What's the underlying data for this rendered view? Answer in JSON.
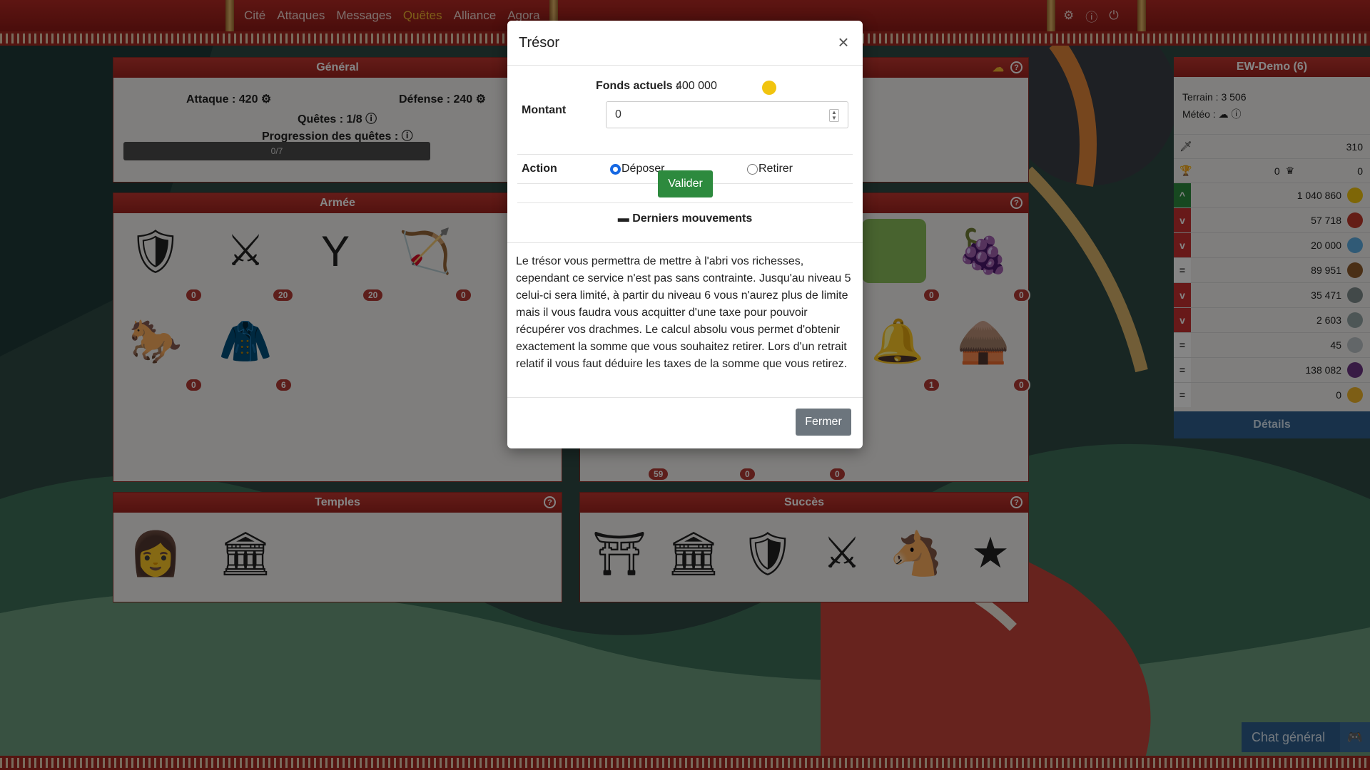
{
  "nav": {
    "items": [
      "Cité",
      "Attaques",
      "Messages",
      "Quêtes",
      "Alliance",
      "Agora"
    ],
    "active_index": 3
  },
  "top_icons": [
    "gear-icon",
    "help-icon",
    "power-icon"
  ],
  "general": {
    "title": "Général",
    "attaque_label": "Attaque : 420",
    "defense_label": "Défense : 240",
    "quetes_label": "Quêtes : 1/8",
    "progression_label": "Progression des quêtes :",
    "progress_text": "0/7",
    "progress_value": 0
  },
  "armee": {
    "title": "Armée",
    "units": [
      {
        "icon": "gladiator-icon",
        "count": "0"
      },
      {
        "icon": "hoplite-icon",
        "count": "20"
      },
      {
        "icon": "slingshot-icon",
        "count": "20"
      },
      {
        "icon": "bow-icon",
        "count": "0"
      },
      {
        "icon": "horse-icon",
        "count": "0"
      },
      {
        "icon": "cloak-icon",
        "count": "6"
      }
    ]
  },
  "buildings": {
    "counts": [
      "0",
      "0",
      "1",
      "0",
      "59",
      "0",
      "0"
    ]
  },
  "temples": {
    "title": "Temples"
  },
  "succes": {
    "title": "Succès"
  },
  "right_panel": {
    "title": "EW-Demo (6)",
    "terrain_label": "Terrain : 3 506",
    "meteo_label": "Météo :",
    "stat_sword": "310",
    "stat_trophy": "0",
    "stat_crown": "0",
    "resources": [
      {
        "value": "1 040 860",
        "icon": "gold-coin-icon",
        "trend": "^",
        "color": "#2d8a3e"
      },
      {
        "value": "57 718",
        "icon": "meat-icon",
        "trend": "v",
        "color": "#c83030"
      },
      {
        "value": "20 000",
        "icon": "water-drop-icon",
        "trend": "v",
        "color": "#c83030"
      },
      {
        "value": "89 951",
        "icon": "wood-icon",
        "trend": "=",
        "color": "#ffffff"
      },
      {
        "value": "35 471",
        "icon": "stone-icon",
        "trend": "v",
        "color": "#c83030"
      },
      {
        "value": "2 603",
        "icon": "iron-icon",
        "trend": "v",
        "color": "#c83030"
      },
      {
        "value": "45",
        "icon": "marble-icon",
        "trend": "=",
        "color": "#ffffff"
      },
      {
        "value": "138 082",
        "icon": "grapes-icon",
        "trend": "=",
        "color": "#ffffff"
      },
      {
        "value": "0",
        "icon": "citizen-icon",
        "trend": "=",
        "color": "#ffffff"
      }
    ],
    "details_label": "Détails"
  },
  "modal": {
    "title": "Trésor",
    "fonds_label": "Fonds actuels :",
    "fonds_value": "400 000",
    "montant_label": "Montant",
    "montant_value": "0",
    "action_label": "Action",
    "option_deposer": "Déposer",
    "option_retirer": "Retirer",
    "valider_label": "Valider",
    "derniers_label": "Derniers mouvements",
    "description": "Le trésor vous permettra de mettre à l'abri vos richesses, cependant ce service n'est pas sans contrainte. Jusqu'au niveau 5 celui-ci sera limité, à partir du niveau 6 vous n'aurez plus de limite mais il vous faudra vous acquitter d'une taxe pour pouvoir récupérer vos drachmes. Le calcul absolu vous permet d'obtenir exactement la somme que vous souhaitez retirer. Lors d'un retrait relatif il vous faut déduire les taxes de la somme que vous retirez.",
    "fermer_label": "Fermer"
  },
  "chat": {
    "label": "Chat général"
  },
  "colors": {
    "accent": "#b42a24",
    "gold": "#f2b630",
    "blue": "#2e5f8f",
    "green": "#2d8a3e"
  }
}
